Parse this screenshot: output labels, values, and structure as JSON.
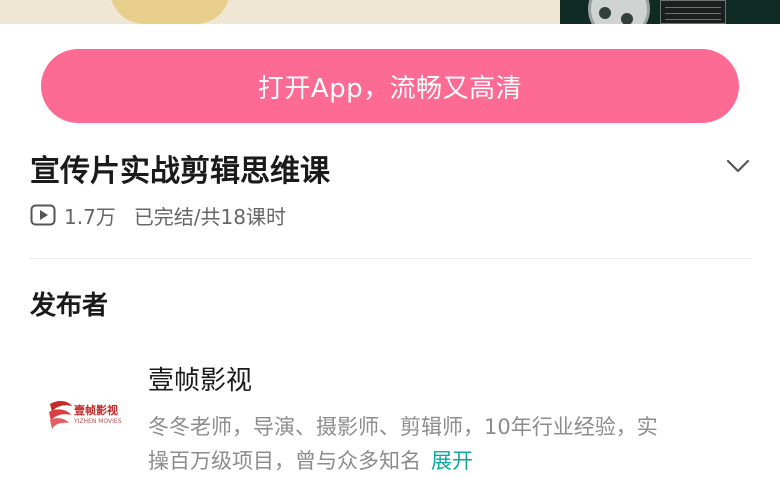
{
  "banner": {
    "open_app_label": "打开App，流畅又高清"
  },
  "course": {
    "title": "宣传片实战剪辑思维课",
    "play_count": "1.7万",
    "status": "已完结/共18课时"
  },
  "publisher": {
    "section_title": "发布者",
    "name": "壹帧影视",
    "logo_text": "壹帧影视",
    "logo_subtext": "YIZHEN MOVIES",
    "bio_line1": "冬冬老师，导演、摄影师、剪辑师，10年行业经验，实",
    "bio_line2": "操百万级项目，曾与众多知名",
    "expand_label": "展开"
  },
  "colors": {
    "accent_pink": "#fd6a94",
    "link_teal": "#11a6a0"
  },
  "icons": {
    "play": "play-icon",
    "expand": "chevron-down-icon"
  }
}
